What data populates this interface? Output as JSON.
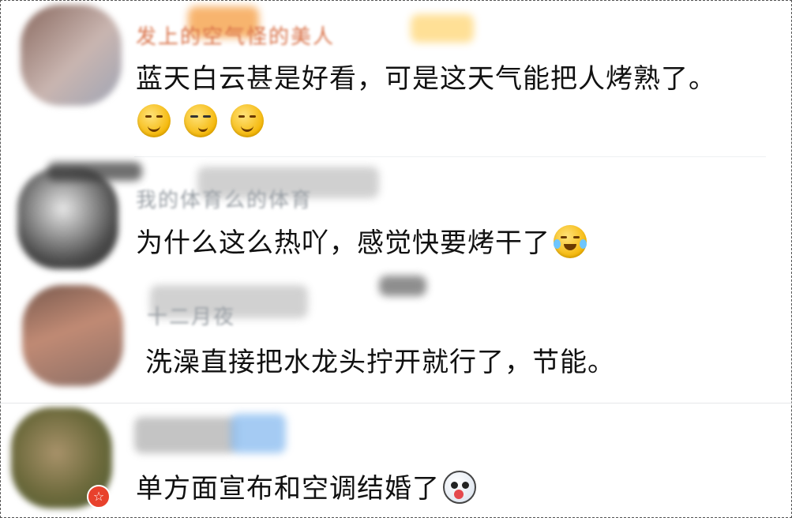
{
  "comments": [
    {
      "username": "发上的空气怪的美人",
      "text": "蓝天白云甚是好看，可是这天气能把人烤熟了。",
      "emojis": [
        "shush-face-icon",
        "sunglasses-smirk-icon",
        "shush-face-icon"
      ]
    },
    {
      "username": "我的体育么的体育",
      "text": "为什么这么热吖，感觉快要烤干了",
      "emojis": [
        "laugh-cry-icon"
      ]
    },
    {
      "username": "十二月夜",
      "text": "洗澡直接把水龙头拧开就行了，节能。",
      "emojis": []
    },
    {
      "username": "",
      "text": "单方面宣布和空调结婚了",
      "emojis": [
        "tongue-out-face-icon"
      ],
      "badge": "☆"
    }
  ],
  "colors": {
    "text": "#111111",
    "username": "#9aa0a6",
    "badge": "#e8412c",
    "emoji_yellow": "#f4b400"
  }
}
